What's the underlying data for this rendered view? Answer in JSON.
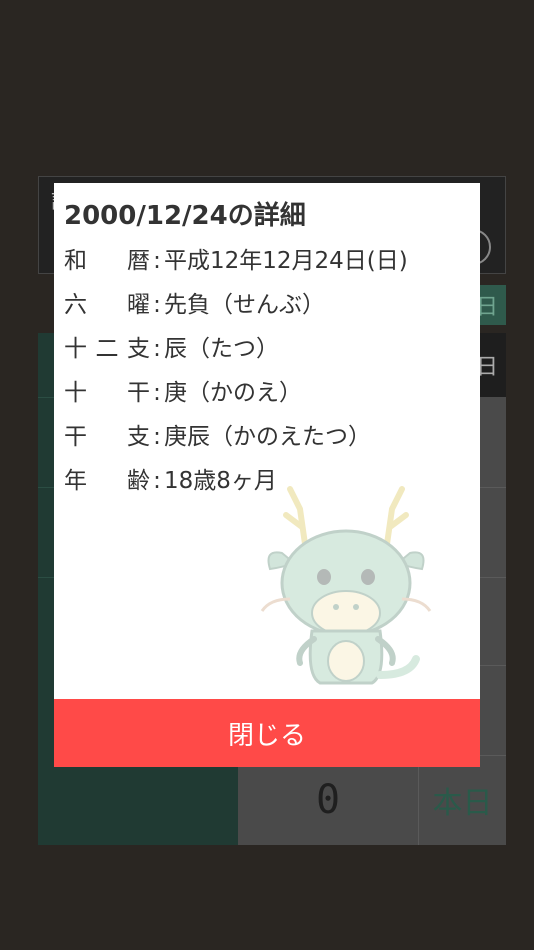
{
  "background": {
    "header_glyph": "詳",
    "sunday_chip": "日",
    "grid_top_right": "日",
    "number_display": "0",
    "today_button": "本日"
  },
  "modal": {
    "title": "2000/12/24の詳細",
    "rows": [
      {
        "label": "和 暦",
        "value": "平成12年12月24日(日)"
      },
      {
        "label": "六 曜",
        "value": "先負（せんぶ）"
      },
      {
        "label": "十二支",
        "value": "辰（たつ）"
      },
      {
        "label": "十 干",
        "value": "庚（かのえ）"
      },
      {
        "label": "干 支",
        "value": "庚辰（かのえたつ）"
      },
      {
        "label": "年 齢",
        "value": "18歳8ヶ月"
      }
    ],
    "close_label": "閉じる",
    "mascot_icon": "dragon-mascot-icon"
  },
  "colors": {
    "close_button": "#ff4a48",
    "modal_bg": "#ffffff",
    "overlay": "#2a2622",
    "mascot": "#8fbfa0"
  }
}
